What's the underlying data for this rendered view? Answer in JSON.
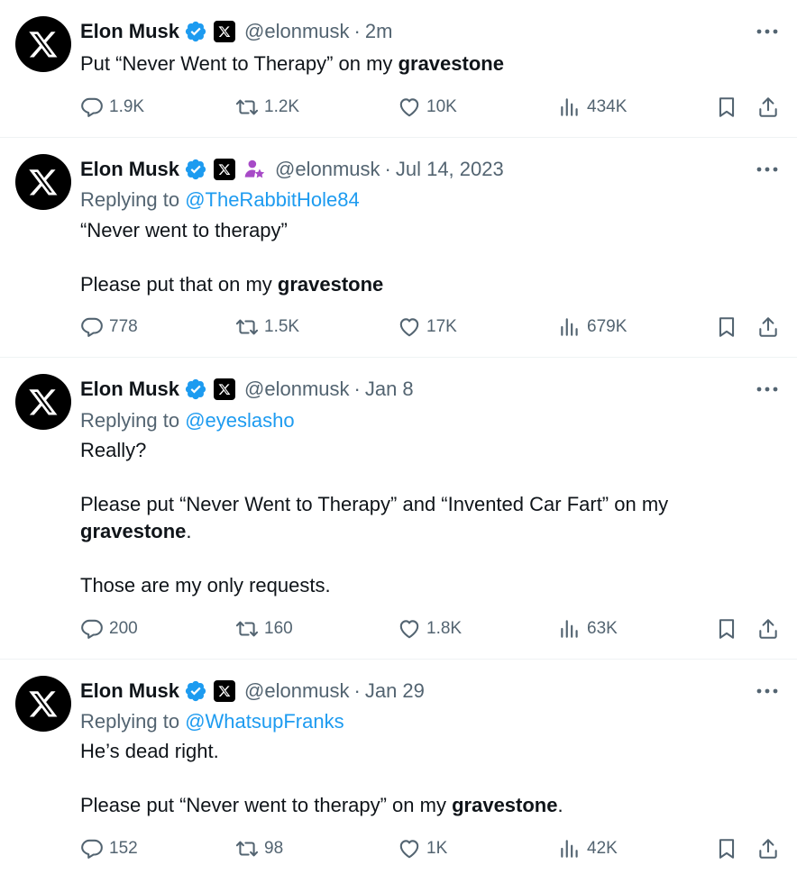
{
  "tweets": [
    {
      "name": "Elon Musk",
      "handle": "@elonmusk",
      "time": "2m",
      "affiliate": false,
      "replying_label": "",
      "replying_to": "",
      "body": [
        {
          "pre": "Put “Never Went to Therapy” on my ",
          "bold": "gravestone",
          "post": ""
        }
      ],
      "stats": {
        "replies": "1.9K",
        "reposts": "1.2K",
        "likes": "10K",
        "views": "434K"
      }
    },
    {
      "name": "Elon Musk",
      "handle": "@elonmusk",
      "time": "Jul 14, 2023",
      "affiliate": true,
      "replying_label": "Replying to ",
      "replying_to": "@TheRabbitHole84",
      "body": [
        {
          "pre": "“Never went to therapy”",
          "bold": "",
          "post": ""
        },
        {
          "pre": "Please put that on my ",
          "bold": "gravestone",
          "post": ""
        }
      ],
      "stats": {
        "replies": "778",
        "reposts": "1.5K",
        "likes": "17K",
        "views": "679K"
      }
    },
    {
      "name": "Elon Musk",
      "handle": "@elonmusk",
      "time": "Jan 8",
      "affiliate": false,
      "replying_label": "Replying to ",
      "replying_to": "@eyeslasho",
      "body": [
        {
          "pre": "Really?",
          "bold": "",
          "post": ""
        },
        {
          "pre": "Please put “Never Went to Therapy” and “Invented Car Fart” on my ",
          "bold": "gravestone",
          "post": "."
        },
        {
          "pre": "Those are my only requests.",
          "bold": "",
          "post": ""
        }
      ],
      "stats": {
        "replies": "200",
        "reposts": "160",
        "likes": "1.8K",
        "views": "63K"
      }
    },
    {
      "name": "Elon Musk",
      "handle": "@elonmusk",
      "time": "Jan 29",
      "affiliate": false,
      "replying_label": "Replying to ",
      "replying_to": "@WhatsupFranks",
      "body": [
        {
          "pre": "He’s dead right.",
          "bold": "",
          "post": ""
        },
        {
          "pre": "Please put “Never went to therapy” on my ",
          "bold": "gravestone",
          "post": "."
        }
      ],
      "stats": {
        "replies": "152",
        "reposts": "98",
        "likes": "1K",
        "views": "42K"
      }
    }
  ],
  "separator": "·",
  "icons": {
    "avatar": "x-logo-icon",
    "verified": "verified-badge-icon",
    "org": "x-org-badge-icon",
    "affiliate": "affiliate-person-icon",
    "more": "more-dots-icon",
    "reply": "reply-bubble-icon",
    "repost": "repost-icon",
    "like": "heart-icon",
    "views": "views-chart-icon",
    "bookmark": "bookmark-icon",
    "share": "share-icon"
  },
  "colors": {
    "text": "#0f1419",
    "secondary": "#536471",
    "link": "#1d9bf0",
    "verified": "#1d9bf0",
    "affiliate": "#a74ac7"
  }
}
